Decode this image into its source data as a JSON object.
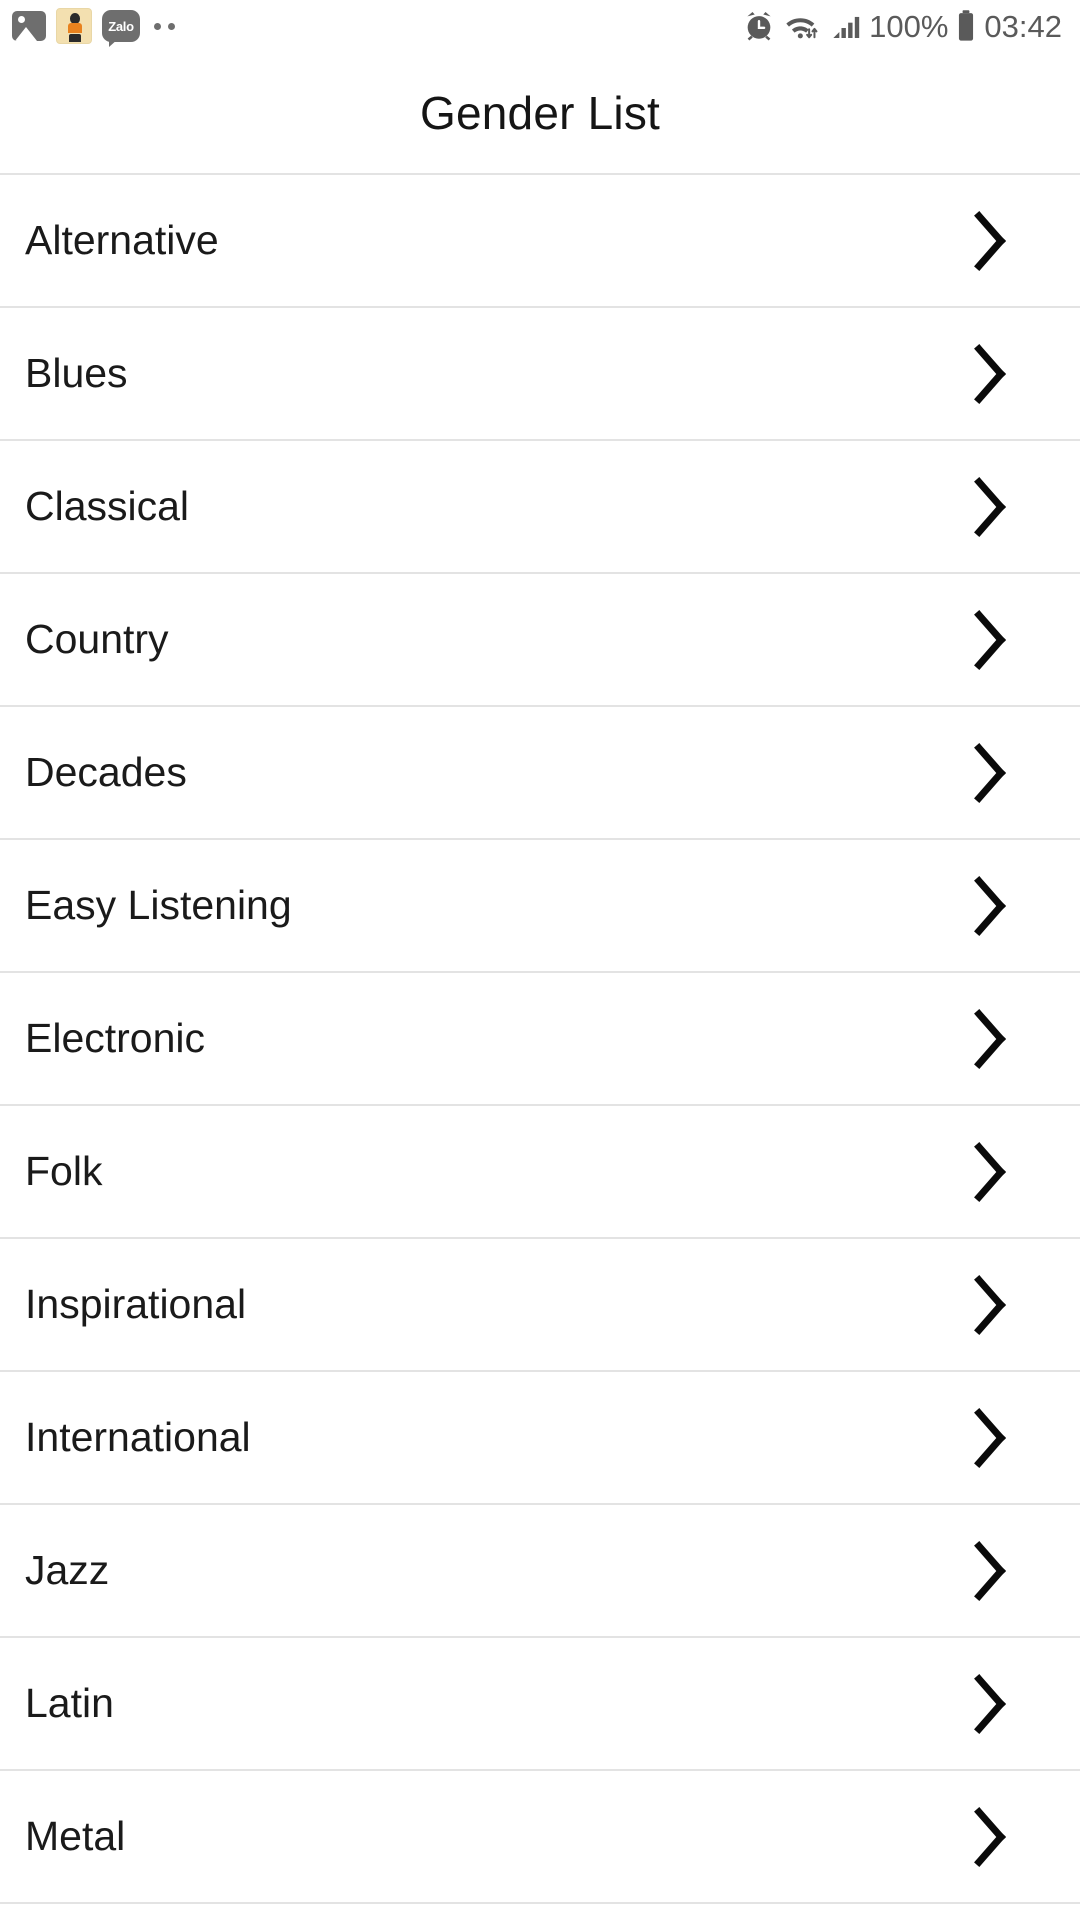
{
  "status_bar": {
    "notifications": [
      {
        "icon": "gallery-icon",
        "label": "Gallery"
      },
      {
        "icon": "app-icon",
        "label": "App"
      },
      {
        "icon": "zalo-icon",
        "label": "Zalo"
      },
      {
        "icon": "more-notifications-icon",
        "label": ""
      }
    ],
    "zalo_label": "Zalo",
    "alarm_icon": "alarm-clock-icon",
    "wifi_icon": "wifi-icon",
    "signal_icon": "cellular-signal-icon",
    "battery_percent": "100%",
    "battery_icon": "battery-full-icon",
    "time": "03:42"
  },
  "header": {
    "title": "Gender List"
  },
  "list": {
    "chevron_icon": "chevron-right-icon",
    "items": [
      {
        "label": "Alternative"
      },
      {
        "label": "Blues"
      },
      {
        "label": "Classical"
      },
      {
        "label": "Country"
      },
      {
        "label": "Decades"
      },
      {
        "label": "Easy Listening"
      },
      {
        "label": "Electronic"
      },
      {
        "label": "Folk"
      },
      {
        "label": "Inspirational"
      },
      {
        "label": "International"
      },
      {
        "label": "Jazz"
      },
      {
        "label": "Latin"
      },
      {
        "label": "Metal"
      }
    ]
  },
  "colors": {
    "background": "#ffffff",
    "text": "#1a1a1a",
    "divider": "#e3e3e3",
    "status_icon": "#5a5a5a"
  }
}
